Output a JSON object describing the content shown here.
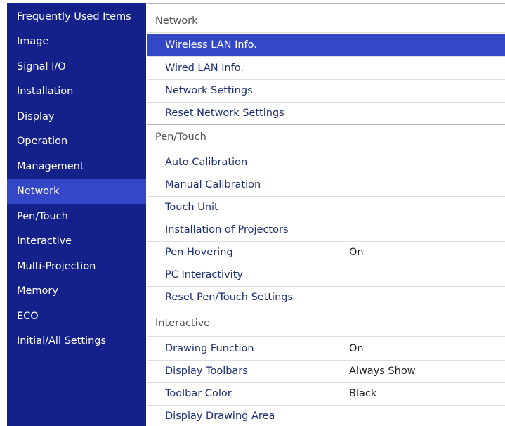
{
  "sidebar": {
    "items": [
      {
        "label": "Frequently Used Items"
      },
      {
        "label": "Image"
      },
      {
        "label": "Signal I/O"
      },
      {
        "label": "Installation"
      },
      {
        "label": "Display"
      },
      {
        "label": "Operation"
      },
      {
        "label": "Management"
      },
      {
        "label": "Network"
      },
      {
        "label": "Pen/Touch"
      },
      {
        "label": "Interactive"
      },
      {
        "label": "Multi-Projection"
      },
      {
        "label": "Memory"
      },
      {
        "label": "ECO"
      },
      {
        "label": "Initial/All Settings"
      }
    ],
    "selected": "Network"
  },
  "sections": {
    "network": {
      "title": "Network",
      "items": [
        {
          "label": "Wireless LAN Info.",
          "value": ""
        },
        {
          "label": "Wired LAN Info.",
          "value": ""
        },
        {
          "label": "Network Settings",
          "value": ""
        },
        {
          "label": "Reset Network Settings",
          "value": ""
        }
      ]
    },
    "pen_touch": {
      "title": "Pen/Touch",
      "items": [
        {
          "label": "Auto Calibration",
          "value": ""
        },
        {
          "label": "Manual Calibration",
          "value": ""
        },
        {
          "label": "Touch Unit",
          "value": ""
        },
        {
          "label": "Installation of Projectors",
          "value": ""
        },
        {
          "label": "Pen Hovering",
          "value": "On"
        },
        {
          "label": "PC Interactivity",
          "value": ""
        },
        {
          "label": "Reset Pen/Touch Settings",
          "value": ""
        }
      ]
    },
    "interactive": {
      "title": "Interactive",
      "items": [
        {
          "label": "Drawing Function",
          "value": "On"
        },
        {
          "label": "Display Toolbars",
          "value": "Always Show"
        },
        {
          "label": "Toolbar Color",
          "value": "Black"
        },
        {
          "label": "Display Drawing Area",
          "value": ""
        }
      ]
    }
  },
  "selected_item": "Wireless LAN Info.",
  "colors": {
    "sidebar_bg": "#14218a",
    "highlight": "#3347c8",
    "item_text": "#1d2f73"
  }
}
